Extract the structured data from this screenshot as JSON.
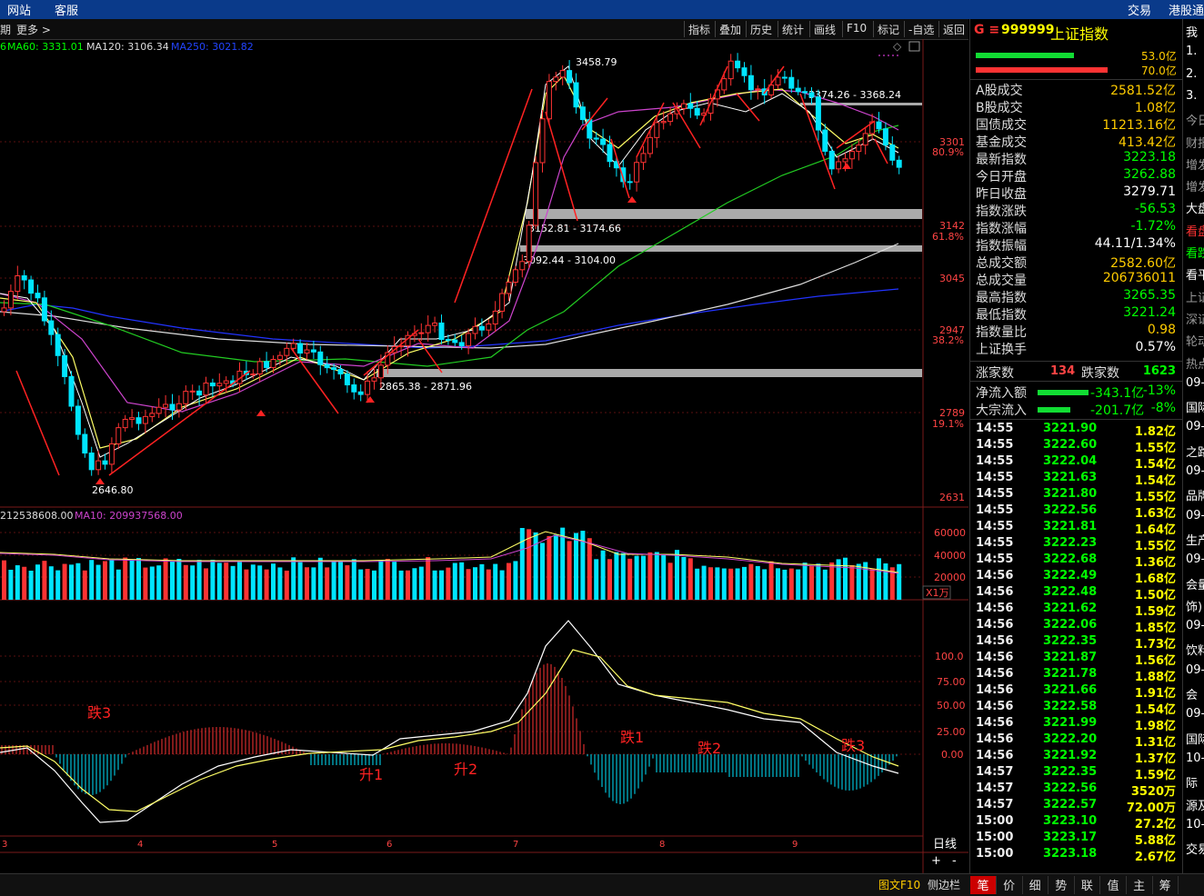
{
  "topbar": {
    "left_items": [
      "网站",
      "客服"
    ],
    "right_items": [
      "交易",
      "港股通"
    ]
  },
  "toolbar": {
    "left_label": "期",
    "more_label": "更多 >",
    "buttons": [
      "指标",
      "叠加",
      "历史",
      "统计",
      "画线",
      "F10",
      "标记",
      "-自选",
      "返回"
    ]
  },
  "ma_legend": {
    "lead": "6",
    "ma60": "MA60: 3331.01",
    "ma120": "MA120: 3106.34",
    "ma250": "MA250: 3021.82"
  },
  "vol_legend": {
    "vol": "212538608.00",
    "ma10": "MA10: 209937568.00"
  },
  "price_axis": [
    {
      "label": "3301",
      "sub": "80.9%"
    },
    {
      "label": "3142",
      "sub": "61.8%"
    },
    {
      "label": "3045",
      "sub": ""
    },
    {
      "label": "2947",
      "sub": "38.2%"
    },
    {
      "label": "2789",
      "sub": "19.1%"
    },
    {
      "label": "2631",
      "sub": ""
    }
  ],
  "vol_axis": [
    "60000",
    "40000",
    "20000",
    "X1万"
  ],
  "macd_axis": [
    "100.0",
    "75.00",
    "50.00",
    "25.00",
    "0.00"
  ],
  "date_axis": [
    "3",
    "4",
    "5",
    "6",
    "7",
    "8",
    "9"
  ],
  "annotations": {
    "high": "3458.79",
    "low": "2646.80",
    "zone1": "3374.26 - 3368.24",
    "zone2": "3152.81 - 3174.66",
    "zone3": "3092.44 - 3104.00",
    "zone4": "2865.38 - 2871.96"
  },
  "macd_labels": [
    "跌3",
    "升1",
    "升2",
    "跌1",
    "跌2",
    "跌3"
  ],
  "period_label": "日线",
  "plus_minus": [
    "+",
    "-",
    "×"
  ],
  "colors": {
    "up": "#ff3333",
    "down": "#00e5ff",
    "accent": "#ffcc00",
    "green": "#00ff00"
  },
  "right_panel": {
    "code_prefix": "G ≡",
    "code": "999999",
    "name": "上证指数",
    "bar1": "53.0亿",
    "bar2": "70.0亿",
    "quotes": [
      {
        "label": "A股成交",
        "value": "2581.52亿",
        "color": "#ffcc00"
      },
      {
        "label": "B股成交",
        "value": "1.08亿",
        "color": "#ffcc00"
      },
      {
        "label": "国债成交",
        "value": "11213.16亿",
        "color": "#ffcc00"
      },
      {
        "label": "基金成交",
        "value": "413.42亿",
        "color": "#ffcc00"
      },
      {
        "label": "最新指数",
        "value": "3223.18",
        "color": "#00ff00"
      },
      {
        "label": "今日开盘",
        "value": "3262.88",
        "color": "#00ff00"
      },
      {
        "label": "昨日收盘",
        "value": "3279.71",
        "color": "#ffffff"
      },
      {
        "label": "指数涨跌",
        "value": "-56.53",
        "color": "#00ff00"
      },
      {
        "label": "指数涨幅",
        "value": "-1.72%",
        "color": "#00ff00"
      },
      {
        "label": "指数振幅",
        "value": "44.11/1.34%",
        "color": "#ffffff"
      },
      {
        "label": "总成交额",
        "value": "2582.60亿",
        "color": "#ffcc00"
      },
      {
        "label": "总成交量",
        "value": "206736011",
        "color": "#ffcc00"
      },
      {
        "label": "最高指数",
        "value": "3265.35",
        "color": "#00ff00"
      },
      {
        "label": "最低指数",
        "value": "3221.24",
        "color": "#00ff00"
      },
      {
        "label": "指数量比",
        "value": "0.98",
        "color": "#ffcc00"
      },
      {
        "label": "上证换手",
        "value": "0.57%",
        "color": "#ffffff"
      }
    ],
    "up_label": "涨家数",
    "up_count": "134",
    "down_label": "跌家数",
    "down_count": "1623",
    "flow": [
      {
        "label": "净流入额",
        "value": "-343.1亿",
        "pct": "-13%"
      },
      {
        "label": "大宗流入",
        "value": "-201.7亿",
        "pct": "-8%"
      }
    ],
    "ticks": [
      {
        "t": "14:55",
        "p": "3221.90",
        "v": "1.82亿"
      },
      {
        "t": "14:55",
        "p": "3222.60",
        "v": "1.55亿"
      },
      {
        "t": "14:55",
        "p": "3222.04",
        "v": "1.54亿"
      },
      {
        "t": "14:55",
        "p": "3221.63",
        "v": "1.54亿"
      },
      {
        "t": "14:55",
        "p": "3221.80",
        "v": "1.55亿"
      },
      {
        "t": "14:55",
        "p": "3222.56",
        "v": "1.63亿"
      },
      {
        "t": "14:55",
        "p": "3221.81",
        "v": "1.64亿"
      },
      {
        "t": "14:55",
        "p": "3222.23",
        "v": "1.55亿"
      },
      {
        "t": "14:55",
        "p": "3222.68",
        "v": "1.36亿"
      },
      {
        "t": "14:56",
        "p": "3222.49",
        "v": "1.68亿"
      },
      {
        "t": "14:56",
        "p": "3222.48",
        "v": "1.50亿"
      },
      {
        "t": "14:56",
        "p": "3221.62",
        "v": "1.59亿"
      },
      {
        "t": "14:56",
        "p": "3222.06",
        "v": "1.85亿"
      },
      {
        "t": "14:56",
        "p": "3222.35",
        "v": "1.73亿"
      },
      {
        "t": "14:56",
        "p": "3221.87",
        "v": "1.56亿"
      },
      {
        "t": "14:56",
        "p": "3221.78",
        "v": "1.88亿"
      },
      {
        "t": "14:56",
        "p": "3221.66",
        "v": "1.91亿"
      },
      {
        "t": "14:56",
        "p": "3222.58",
        "v": "1.54亿"
      },
      {
        "t": "14:56",
        "p": "3221.99",
        "v": "1.98亿"
      },
      {
        "t": "14:56",
        "p": "3222.20",
        "v": "1.31亿"
      },
      {
        "t": "14:56",
        "p": "3221.92",
        "v": "1.37亿"
      },
      {
        "t": "14:57",
        "p": "3222.35",
        "v": "1.59亿"
      },
      {
        "t": "14:57",
        "p": "3222.56",
        "v": "3520万"
      },
      {
        "t": "14:57",
        "p": "3222.57",
        "v": "72.00万"
      },
      {
        "t": "15:00",
        "p": "3223.10",
        "v": "27.2亿"
      },
      {
        "t": "15:00",
        "p": "3223.17",
        "v": "5.88亿"
      },
      {
        "t": "15:00",
        "p": "3223.18",
        "v": "2.67亿"
      }
    ],
    "tabs": [
      "笔",
      "价",
      "细",
      "势",
      "联",
      "值",
      "主",
      "筹"
    ]
  },
  "far_column": [
    {
      "text": "我",
      "color": "#fff"
    },
    {
      "text": "1.",
      "color": "#fff"
    },
    {
      "text": "2.",
      "color": "#fff"
    },
    {
      "text": "3.",
      "color": "#fff"
    },
    {
      "text": "今日",
      "color": "#999"
    },
    {
      "text": "财报",
      "color": "#999"
    },
    {
      "text": "增发",
      "color": "#999"
    },
    {
      "text": "增发",
      "color": "#999"
    },
    {
      "text": "大盘",
      "color": "#fff"
    },
    {
      "text": "看盘",
      "color": "#f33"
    },
    {
      "text": "看跌",
      "color": "#0f0"
    },
    {
      "text": "看平",
      "color": "#fff"
    },
    {
      "text": "上证",
      "color": "#999"
    },
    {
      "text": "深证",
      "color": "#999"
    },
    {
      "text": "轮动",
      "color": "#999"
    },
    {
      "text": "热点",
      "color": "#999"
    },
    {
      "text": "09-",
      "color": "#fff"
    },
    {
      "text": "国际",
      "color": "#fff"
    },
    {
      "text": "09-",
      "color": "#fff"
    },
    {
      "text": "之路",
      "color": "#fff"
    },
    {
      "text": "09-",
      "color": "#fff"
    },
    {
      "text": "品牌",
      "color": "#fff"
    },
    {
      "text": "09-",
      "color": "#fff"
    },
    {
      "text": "生产",
      "color": "#fff"
    },
    {
      "text": "09-",
      "color": "#fff"
    },
    {
      "text": "会量",
      "color": "#fff"
    },
    {
      "text": "饰)",
      "color": "#fff"
    },
    {
      "text": "09-",
      "color": "#fff"
    },
    {
      "text": "饮料",
      "color": "#fff"
    },
    {
      "text": "09-",
      "color": "#fff"
    },
    {
      "text": "会",
      "color": "#fff"
    },
    {
      "text": "09-",
      "color": "#fff"
    },
    {
      "text": "国际",
      "color": "#fff"
    },
    {
      "text": "10-",
      "color": "#fff"
    },
    {
      "text": "际",
      "color": "#fff"
    },
    {
      "text": "源及",
      "color": "#fff"
    },
    {
      "text": "10-",
      "color": "#fff"
    },
    {
      "text": "交易",
      "color": "#fff"
    }
  ],
  "bottom_buttons": [
    "图文F10",
    "侧边栏"
  ]
}
